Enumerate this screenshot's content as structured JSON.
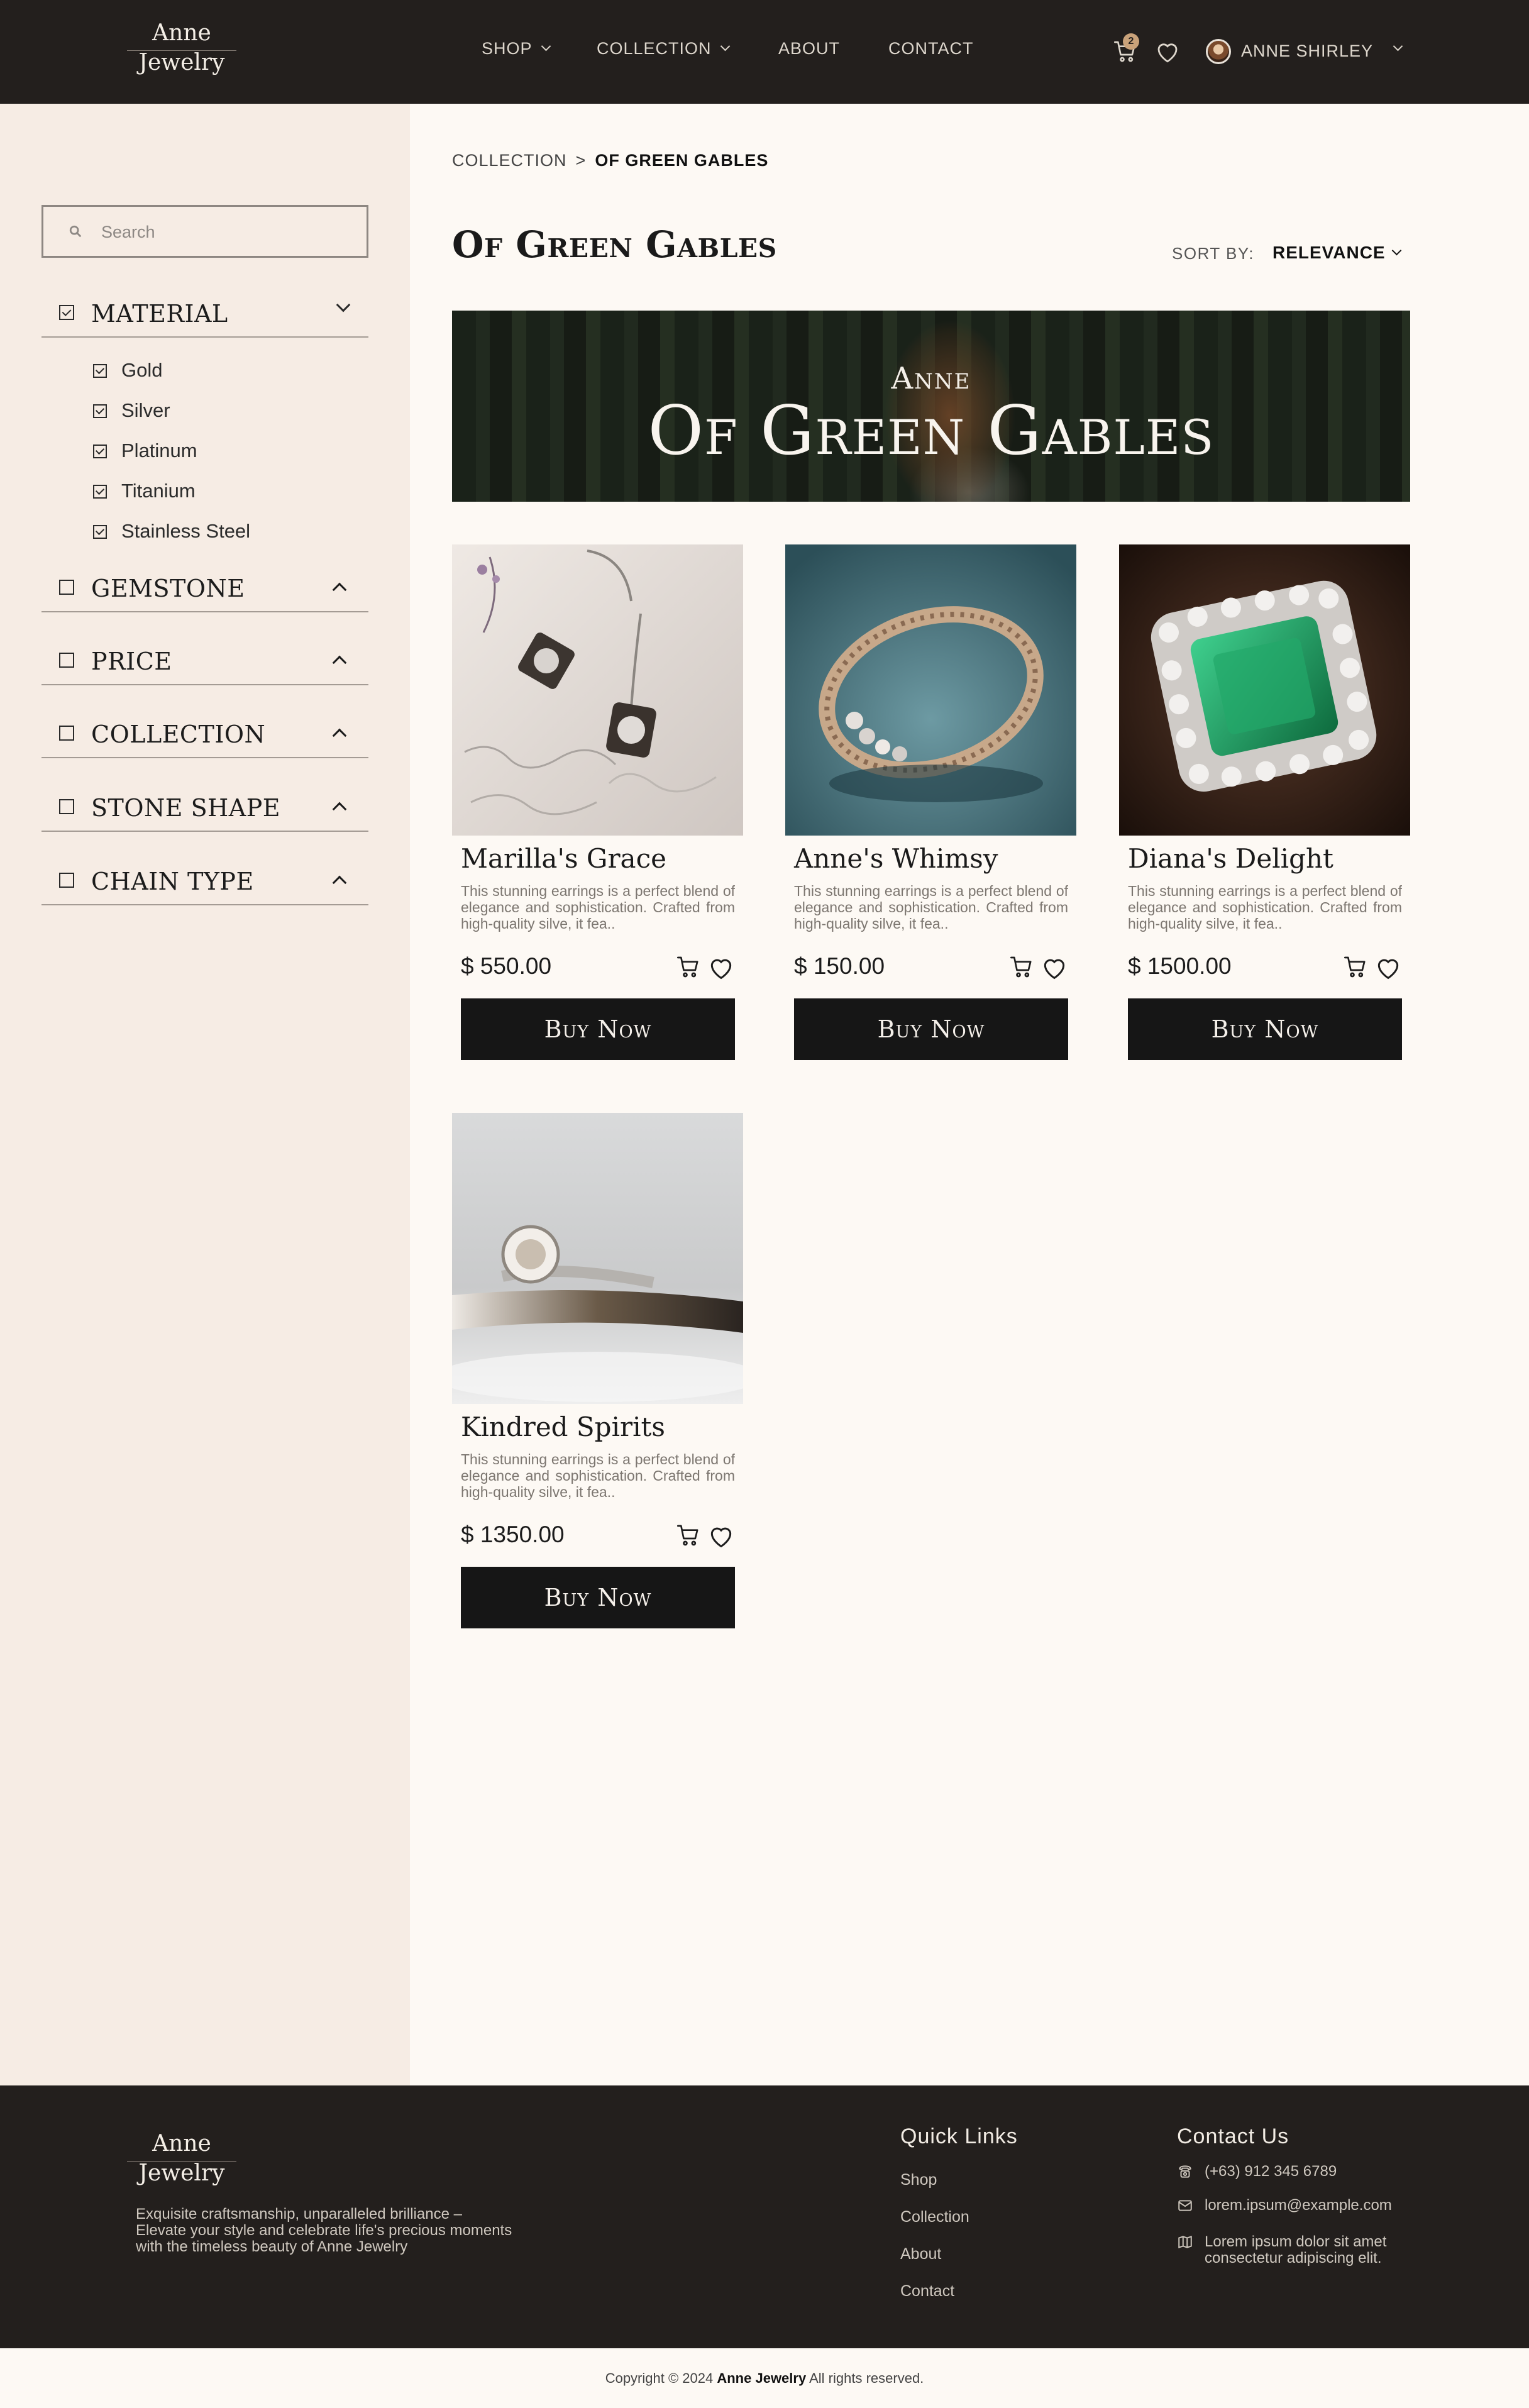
{
  "brand": {
    "line1": "Anne",
    "line2": "Jewelry"
  },
  "nav": {
    "items": [
      {
        "label": "SHOP",
        "dropdown": true
      },
      {
        "label": "COLLECTION",
        "dropdown": true
      },
      {
        "label": "ABOUT",
        "dropdown": false
      },
      {
        "label": "CONTACT",
        "dropdown": false
      }
    ],
    "cart_count": "2",
    "user_name": "ANNE SHIRLEY"
  },
  "sidebar": {
    "search_placeholder": "Search",
    "filters": [
      {
        "label": "MATERIAL",
        "checked": true,
        "expanded": true,
        "options": [
          "Gold",
          "Silver",
          "Platinum",
          "Titanium",
          "Stainless Steel"
        ]
      },
      {
        "label": "GEMSTONE",
        "checked": false,
        "expanded": false
      },
      {
        "label": "PRICE",
        "checked": false,
        "expanded": false
      },
      {
        "label": "COLLECTION",
        "checked": false,
        "expanded": false
      },
      {
        "label": "STONE SHAPE",
        "checked": false,
        "expanded": false
      },
      {
        "label": "CHAIN TYPE",
        "checked": false,
        "expanded": false
      }
    ]
  },
  "breadcrumb": {
    "parent": "COLLECTION",
    "separator": ">",
    "current": "OF GREEN GABLES"
  },
  "page_title": "Of Green Gables",
  "sort": {
    "label": "SORT BY:",
    "value": "RELEVANCE"
  },
  "banner": {
    "subtitle": "Anne",
    "title": "Of Green Gables"
  },
  "products": [
    {
      "name": "Marilla's Grace",
      "description": "This stunning earrings is a perfect blend of elegance and sophistication. Crafted from high-quality silve, it fea..",
      "price": "$ 550.00",
      "button": "Buy Now"
    },
    {
      "name": "Anne's Whimsy",
      "description": "This stunning earrings is a perfect blend of elegance and sophistication. Crafted from high-quality silve, it fea..",
      "price": "$ 150.00",
      "button": "Buy Now"
    },
    {
      "name": "Diana's Delight",
      "description": "This stunning earrings is a perfect blend of elegance and sophistication. Crafted from high-quality silve, it fea..",
      "price": "$ 1500.00",
      "button": "Buy Now"
    },
    {
      "name": "Kindred Spirits",
      "description": "This stunning earrings is a perfect blend of elegance and sophistication. Crafted from high-quality silve, it fea..",
      "price": "$ 1350.00",
      "button": "Buy Now"
    }
  ],
  "footer": {
    "tagline": "Exquisite craftsmanship, unparalleled brilliance – Elevate your style and celebrate life's precious moments with the timeless beauty of Anne Jewelry",
    "quick_links_title": "Quick Links",
    "quick_links": [
      "Shop",
      "Collection",
      "About",
      "Contact"
    ],
    "contact_title": "Contact Us",
    "phone": "(+63) 912 345 6789",
    "email": "lorem.ipsum@example.com",
    "address": "Lorem ipsum dolor sit amet consectetur adipiscing elit."
  },
  "copyright": {
    "prefix": "Copyright © 2024",
    "brand": "Anne Jewelry",
    "suffix": "All rights reserved."
  },
  "colors": {
    "header_bg": "#231f1d",
    "sidebar_bg": "#f6ece4",
    "page_bg": "#fdf9f4",
    "button_bg": "#161616",
    "accent": "#c9a27a"
  }
}
